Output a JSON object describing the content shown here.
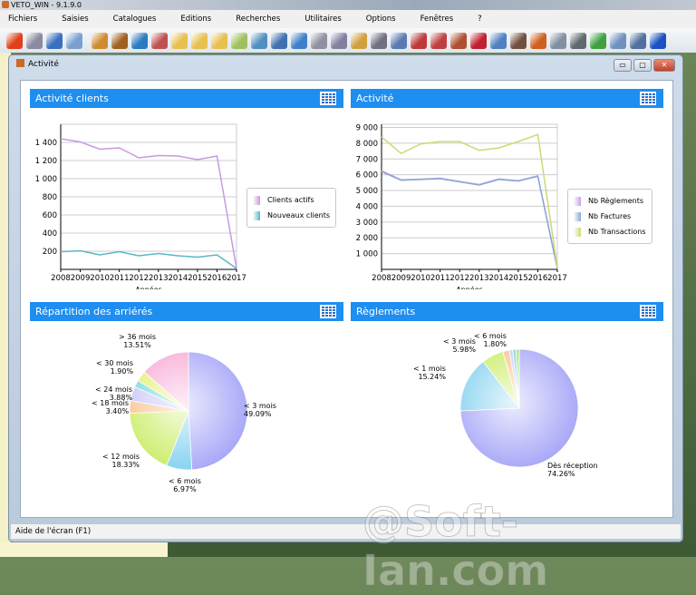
{
  "app": {
    "title": "VETO_WIN - 9.1.9.0"
  },
  "menu": [
    "Fichiers",
    "Saisies",
    "Catalogues",
    "Editions",
    "Recherches",
    "Utilitaires",
    "Options",
    "Fenêtres",
    "?"
  ],
  "toolbar_icons": [
    {
      "name": "power-icon",
      "color": "#e0401a"
    },
    {
      "name": "broom-icon",
      "color": "#8a8aa0"
    },
    {
      "name": "save-icon",
      "color": "#3a70c0"
    },
    {
      "name": "sync-icon",
      "color": "#7aa0d0"
    },
    {
      "name": "clients-icon",
      "color": "#d08a30"
    },
    {
      "name": "animal-icon",
      "color": "#a06020"
    },
    {
      "name": "globe-icon",
      "color": "#2a7ac0"
    },
    {
      "name": "books-icon",
      "color": "#c05050"
    },
    {
      "name": "folder-icon",
      "color": "#e8c050"
    },
    {
      "name": "folder-doc-icon",
      "color": "#e8c050"
    },
    {
      "name": "folder-edit-icon",
      "color": "#e8c050"
    },
    {
      "name": "folder-check-icon",
      "color": "#a0c060"
    },
    {
      "name": "network-icon",
      "color": "#5090c0"
    },
    {
      "name": "hierarchy-icon",
      "color": "#4070b0"
    },
    {
      "name": "computer-icon",
      "color": "#4080c8"
    },
    {
      "name": "print-doc-icon",
      "color": "#9090a0"
    },
    {
      "name": "scanner-icon",
      "color": "#8080a0"
    },
    {
      "name": "key-icon",
      "color": "#d0a040"
    },
    {
      "name": "printer-icon",
      "color": "#707080"
    },
    {
      "name": "report-icon",
      "color": "#5a7ab0"
    },
    {
      "name": "stats-icon",
      "color": "#c03a3a"
    },
    {
      "name": "register-icon",
      "color": "#c04040"
    },
    {
      "name": "chart-bar-icon",
      "color": "#b05030"
    },
    {
      "name": "heart-icon",
      "color": "#c02030"
    },
    {
      "name": "book-icon",
      "color": "#5080c0"
    },
    {
      "name": "users-icon",
      "color": "#705040"
    },
    {
      "name": "home-icon",
      "color": "#d06020"
    },
    {
      "name": "team-icon",
      "color": "#8090a0"
    },
    {
      "name": "text-icon",
      "color": "#606870"
    },
    {
      "name": "mail-icon",
      "color": "#40a040"
    },
    {
      "name": "phone-icon",
      "color": "#7090c0"
    },
    {
      "name": "calendar-icon",
      "color": "#5070a0"
    },
    {
      "name": "help-icon",
      "color": "#1a50c0"
    }
  ],
  "window": {
    "title": "Activité",
    "minimize": "▭",
    "restore": "▢",
    "close": "✕"
  },
  "panels": {
    "clients": "Activité clients",
    "activite": "Activité",
    "arrieres": "Répartition des arriérés",
    "reglements": "Règlements"
  },
  "status": {
    "help": "Aide de l'écran (F1)"
  },
  "watermark": "@Soft-Ian.com",
  "chart_data": [
    {
      "type": "line",
      "title": "Activité clients",
      "xlabel": "Années",
      "ylabel": "",
      "ylim": [
        0,
        1600
      ],
      "x": [
        "2008",
        "2009",
        "2010",
        "2011",
        "2012",
        "2013",
        "2014",
        "2015",
        "2016",
        "2017"
      ],
      "yticks": [
        200,
        400,
        600,
        800,
        1000,
        1200,
        1400
      ],
      "ytick_labels": [
        "200",
        "400",
        "600",
        "800",
        "1 000",
        "1 200",
        "1 400"
      ],
      "series": [
        {
          "name": "Clients actifs",
          "color": "#c89ae0",
          "values": [
            1440,
            1405,
            1325,
            1340,
            1230,
            1255,
            1250,
            1210,
            1250,
            10
          ]
        },
        {
          "name": "Nouveaux clients",
          "color": "#58b8c8",
          "values": [
            195,
            205,
            160,
            195,
            150,
            175,
            150,
            135,
            160,
            10
          ]
        }
      ],
      "legend": "right",
      "grid": true
    },
    {
      "type": "line",
      "title": "Activité",
      "xlabel": "Années",
      "ylabel": "",
      "ylim": [
        0,
        9200
      ],
      "x": [
        "2008",
        "2009",
        "2010",
        "2011",
        "2012",
        "2013",
        "2014",
        "2015",
        "2016",
        "2017"
      ],
      "yticks": [
        1000,
        2000,
        3000,
        4000,
        5000,
        6000,
        7000,
        8000,
        9000
      ],
      "ytick_labels": [
        "1 000",
        "2 000",
        "3 000",
        "4 000",
        "5 000",
        "6 000",
        "7 000",
        "8 000",
        "9 000"
      ],
      "series": [
        {
          "name": "Nb Règlements",
          "color": "#c8a0e8",
          "values": [
            6250,
            5680,
            5720,
            5780,
            5570,
            5380,
            5730,
            5620,
            5930,
            60
          ]
        },
        {
          "name": "Nb Factures",
          "color": "#8aa8d8",
          "values": [
            6200,
            5650,
            5700,
            5750,
            5550,
            5350,
            5700,
            5600,
            5900,
            50
          ]
        },
        {
          "name": "Nb Transactions",
          "color": "#c8dc70",
          "values": [
            8400,
            7350,
            7950,
            8100,
            8100,
            7550,
            7700,
            8100,
            8550,
            100
          ]
        }
      ],
      "legend": "right",
      "grid": true
    },
    {
      "type": "pie",
      "title": "Répartition des arriérés",
      "slices": [
        {
          "label": "< 3 mois",
          "pct": "49.09%",
          "value": 49.09,
          "color": "#a4a4f8"
        },
        {
          "label": "< 6 mois",
          "pct": "6.97%",
          "value": 6.97,
          "color": "#80d0f0"
        },
        {
          "label": "< 12 mois",
          "pct": "18.33%",
          "value": 18.33,
          "color": "#c8ec60"
        },
        {
          "label": "< 18 mois",
          "pct": "3.40%",
          "value": 3.4,
          "color": "#f8c088"
        },
        {
          "label": "< 24 mois",
          "pct": "3.88%",
          "value": 3.88,
          "color": "#c8c4f8"
        },
        {
          "label": "< 30 mois",
          "pct": "1.90%",
          "value": 1.9,
          "color": "#70d8d8"
        },
        {
          "value": 2.92,
          "color": "#e4f070"
        },
        {
          "label": "> 36 mois",
          "pct": "13.51%",
          "value": 13.51,
          "color": "#f8a8d4"
        }
      ]
    },
    {
      "type": "pie",
      "title": "Règlements",
      "slices": [
        {
          "label": "Dès réception",
          "pct": "74.26%",
          "value": 74.26,
          "color": "#a4a4f8"
        },
        {
          "label": "< 1 mois",
          "pct": "15.24%",
          "value": 15.24,
          "color": "#80d0f0"
        },
        {
          "label": "< 3 mois",
          "pct": "5.98%",
          "value": 5.98,
          "color": "#c8ec60"
        },
        {
          "label": "< 6 mois",
          "pct": "1.80%",
          "value": 1.8,
          "color": "#f8c088"
        },
        {
          "value": 0.9,
          "color": "#c8c4f8"
        },
        {
          "value": 0.9,
          "color": "#70d8d8"
        },
        {
          "value": 0.92,
          "color": "#a0e070"
        }
      ]
    }
  ]
}
